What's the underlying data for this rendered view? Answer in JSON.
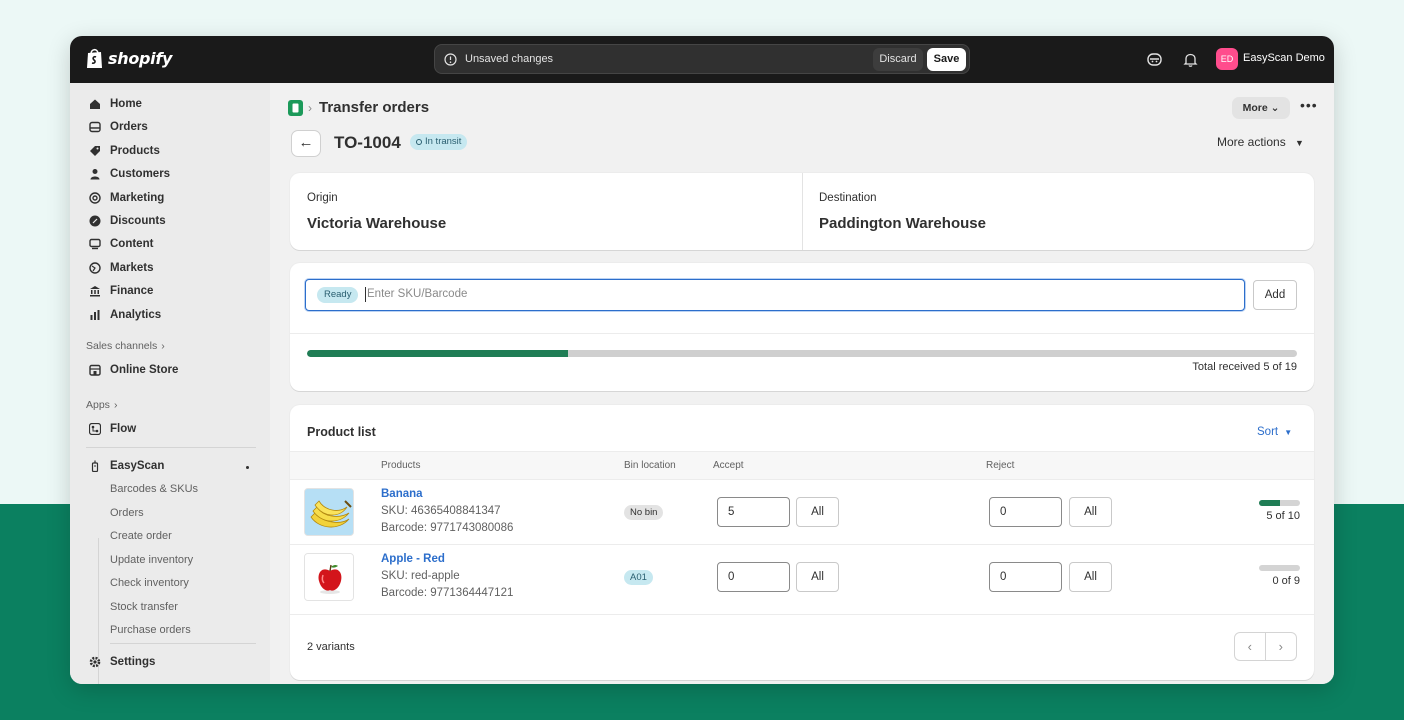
{
  "topbar": {
    "brand": "shopify",
    "unsaved_text": "Unsaved changes",
    "discard_label": "Discard",
    "save_label": "Save",
    "avatar_initials": "ED",
    "store_name": "EasyScan Demo"
  },
  "sidebar": {
    "items": [
      {
        "label": "Home",
        "icon": "home-icon"
      },
      {
        "label": "Orders",
        "icon": "inbox-icon"
      },
      {
        "label": "Products",
        "icon": "tag-icon"
      },
      {
        "label": "Customers",
        "icon": "person-icon"
      },
      {
        "label": "Marketing",
        "icon": "target-icon"
      },
      {
        "label": "Discounts",
        "icon": "discount-icon"
      },
      {
        "label": "Content",
        "icon": "content-icon"
      },
      {
        "label": "Markets",
        "icon": "globe-icon"
      },
      {
        "label": "Finance",
        "icon": "bank-icon"
      },
      {
        "label": "Analytics",
        "icon": "bar-chart-icon"
      }
    ],
    "sales_channels_label": "Sales channels",
    "online_store": "Online Store",
    "apps_label": "Apps",
    "flow": "Flow",
    "easyscan": "EasyScan",
    "easyscan_sub": [
      "Barcodes & SKUs",
      "Orders",
      "Create order",
      "Update inventory",
      "Check inventory",
      "Stock transfer",
      "Purchase orders"
    ],
    "settings": "Settings"
  },
  "header": {
    "page_title": "Transfer orders",
    "more_label": "More",
    "dots_label": "•••"
  },
  "order": {
    "id": "TO-1004",
    "status": "In transit",
    "more_actions": "More actions"
  },
  "origin": {
    "label": "Origin",
    "value": "Victoria Warehouse"
  },
  "destination": {
    "label": "Destination",
    "value": "Paddington Warehouse"
  },
  "scan": {
    "ready": "Ready",
    "placeholder": "Enter SKU/Barcode",
    "add_label": "Add",
    "received": 5,
    "total": 19,
    "total_text": "Total received 5 of 19"
  },
  "product_list": {
    "title": "Product list",
    "sort_label": "Sort",
    "columns": [
      "Products",
      "Bin location",
      "Accept",
      "Reject"
    ],
    "rows": [
      {
        "name": "Banana",
        "sku": "SKU: 46365408841347",
        "barcode": "Barcode: 9771743080086",
        "bin": "No bin",
        "accept": "5",
        "accept_all": "All",
        "reject": "0",
        "reject_all": "All",
        "received": 5,
        "total": 10,
        "progress_text": "5 of 10"
      },
      {
        "name": "Apple - Red",
        "sku": "SKU: red-apple",
        "barcode": "Barcode: 9771364447121",
        "bin": "A01",
        "accept": "0",
        "accept_all": "All",
        "reject": "0",
        "reject_all": "All",
        "received": 0,
        "total": 9,
        "progress_text": "0 of 9"
      }
    ],
    "variants_text": "2 variants"
  },
  "colors": {
    "accent": "#2c6ecb",
    "progress": "#1f7d55",
    "brand_green": "#0b8060"
  }
}
